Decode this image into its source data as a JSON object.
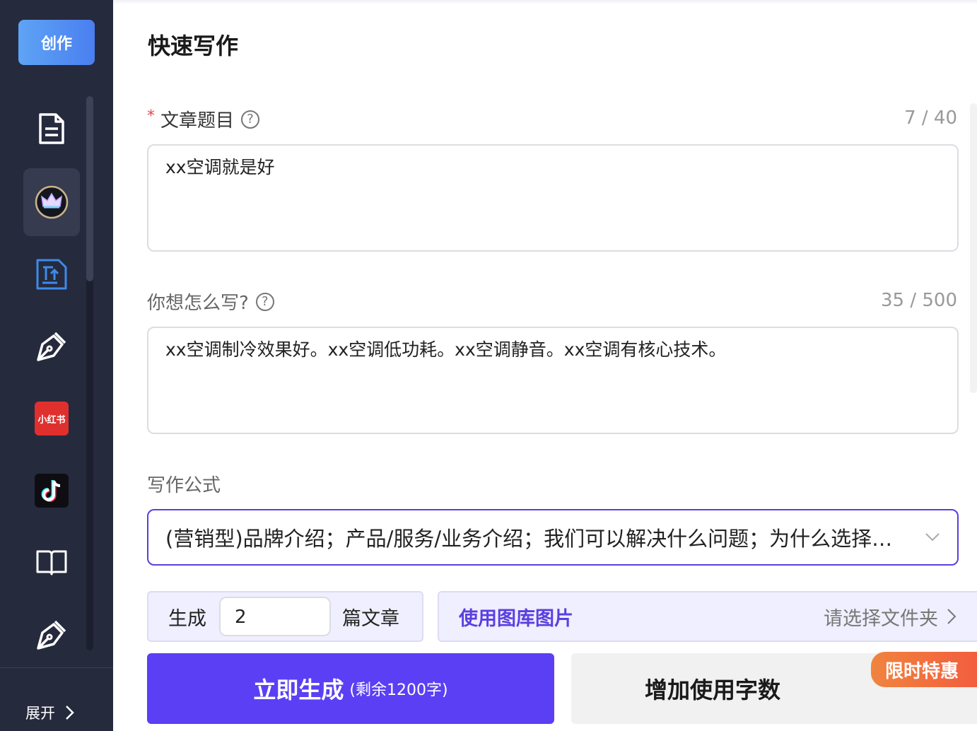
{
  "sidebar": {
    "create_label": "创作",
    "items": [
      {
        "name": "document-icon"
      },
      {
        "name": "crown-icon",
        "active": true
      },
      {
        "name": "text-convert-icon"
      },
      {
        "name": "pen-icon"
      },
      {
        "name": "xiaohongshu-logo",
        "label": "小红书"
      },
      {
        "name": "tiktok-logo"
      },
      {
        "name": "book-icon"
      },
      {
        "name": "pen-icon-2"
      }
    ],
    "expand_label": "展开"
  },
  "main": {
    "title": "快速写作",
    "article_title": {
      "required_mark": "*",
      "label": "文章题目",
      "counter": "7 / 40",
      "value": "xx空调就是好"
    },
    "how_to_write": {
      "label": "你想怎么写?",
      "counter": "35 / 500",
      "value": "xx空调制冷效果好。xx空调低功耗。xx空调静音。xx空调有核心技术。"
    },
    "formula": {
      "label": "写作公式",
      "selected": "(营销型)品牌介绍；产品/服务/业务介绍；我们可以解决什么问题；为什么选择我们"
    },
    "generate_count": {
      "prefix": "生成",
      "value": "2",
      "suffix": "篇文章"
    },
    "gallery": {
      "label": "使用图库图片",
      "placeholder": "请选择文件夹"
    },
    "generate_button": {
      "label": "立即生成",
      "sub": "(剩余1200字)"
    },
    "add_words_button": {
      "label": "增加使用字数",
      "badge": "限时特惠"
    }
  },
  "colors": {
    "sidebar_bg": "#262a3d",
    "accent": "#5b3ff5",
    "promo": "#f35b3d"
  }
}
